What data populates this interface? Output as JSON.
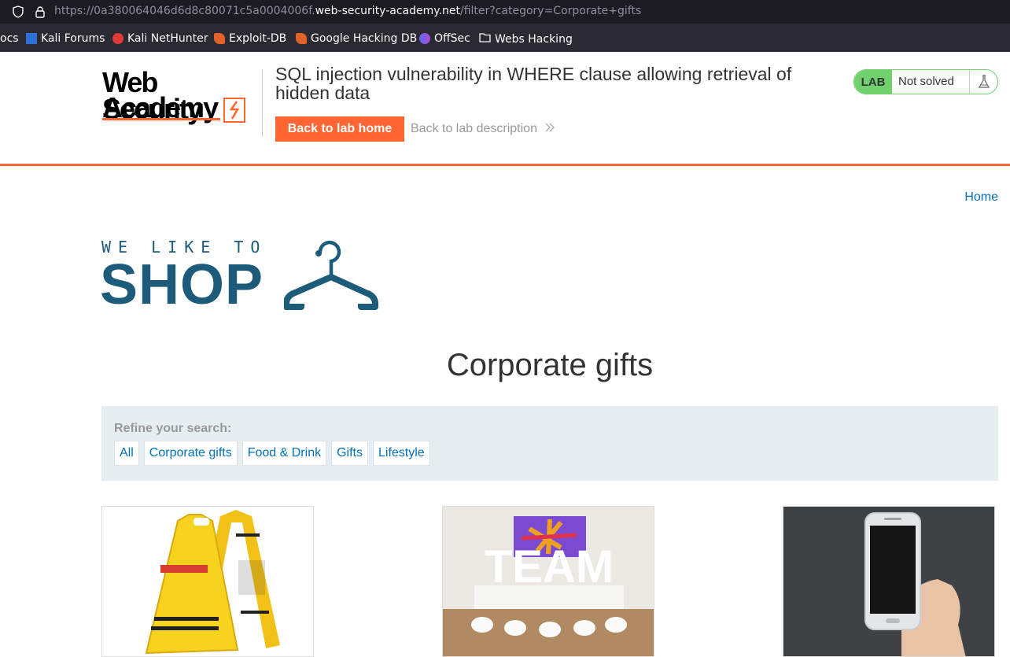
{
  "browser": {
    "url_prefix": "https://0a380064046d6d8c80071c5a0004006f.",
    "url_host": "web-security-academy.net",
    "url_path": "/filter?category=Corporate+gifts",
    "bookmarks": [
      "ocs",
      "Kali Forums",
      "Kali NetHunter",
      "Exploit-DB",
      "Google Hacking DB",
      "OffSec",
      "Webs Hacking"
    ]
  },
  "lab": {
    "logo_line1": "Web Security",
    "logo_line2": "Academy",
    "title": "SQL injection vulnerability in WHERE clause allowing retrieval of hidden data",
    "back_home": "Back to lab home",
    "back_description": "Back to lab description",
    "badge": "LAB",
    "status": "Not solved"
  },
  "nav": {
    "home": "Home"
  },
  "shop_logo": {
    "tagline": "WE LIKE TO",
    "word": "SHOP"
  },
  "category_title": "Corporate gifts",
  "filter": {
    "label": "Refine your search:",
    "categories": [
      "All",
      "Corporate gifts",
      "Food & Drink",
      "Gifts",
      "Lifestyle"
    ]
  },
  "products": [
    {
      "sign_left": "CAUTION DEEPLY SATISFYING POO IN PROGRESS",
      "sign_right": "GIVE IT 10 MINUTES"
    },
    {
      "word": "TEAM"
    },
    {}
  ],
  "colors": {
    "accent": "#ff6633",
    "link": "#0071bc",
    "shop_blue": "#1d5b7a",
    "lab_green": "#70d16d"
  }
}
